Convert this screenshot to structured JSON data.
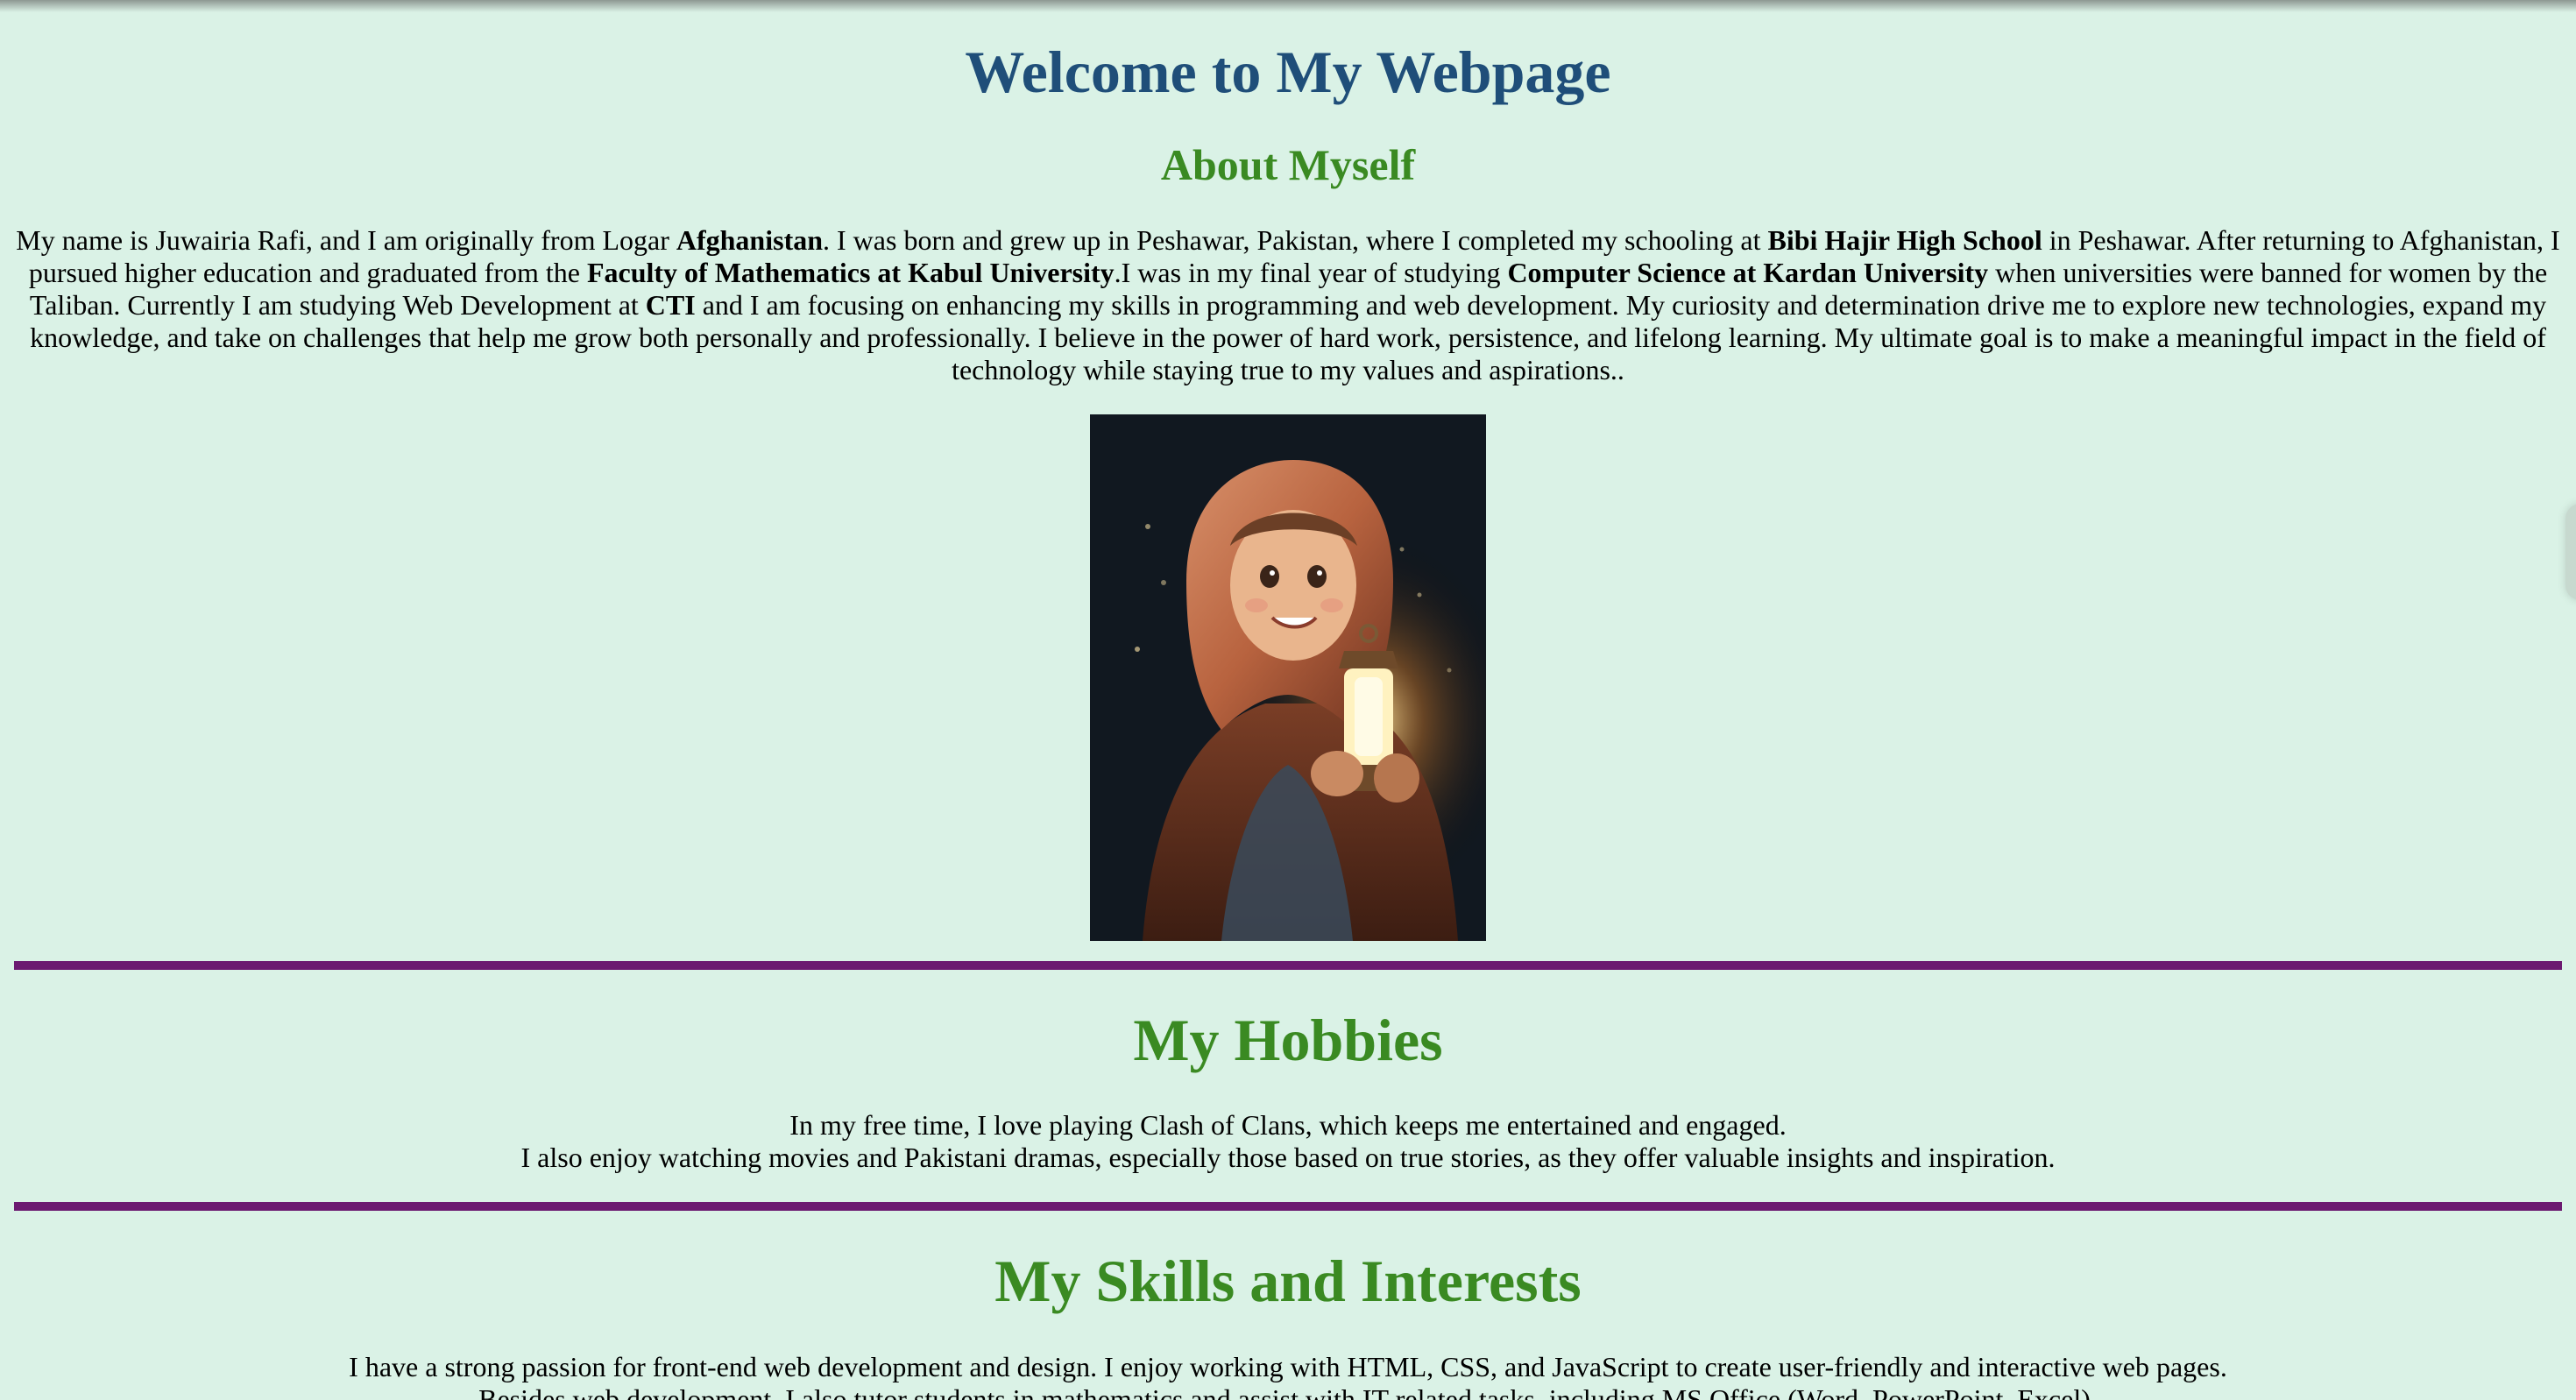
{
  "header": {
    "title": "Welcome to My Webpage"
  },
  "about": {
    "heading": "About Myself",
    "segments": [
      {
        "text": "My name is Juwairia Rafi, and I am originally from Logar ",
        "bold": false
      },
      {
        "text": "Afghanistan",
        "bold": true
      },
      {
        "text": ". I was born and grew up in Peshawar, Pakistan, where I completed my schooling at ",
        "bold": false
      },
      {
        "text": "Bibi Hajir High School",
        "bold": true
      },
      {
        "text": " in Peshawar. After returning to Afghanistan, I pursued higher education and graduated from the ",
        "bold": false
      },
      {
        "text": "Faculty of Mathematics at Kabul University",
        "bold": true
      },
      {
        "text": ".I was in my final year of studying ",
        "bold": false
      },
      {
        "text": "Computer Science at Kardan University",
        "bold": true
      },
      {
        "text": " when universities were banned for women by the Taliban. Currently I am studying Web Development at ",
        "bold": false
      },
      {
        "text": "CTI",
        "bold": true
      },
      {
        "text": " and I am focusing on enhancing my skills in programming and web development. My curiosity and determination drive me to explore new technologies, expand my knowledge, and take on challenges that help me grow both personally and professionally. I believe in the power of hard work, persistence, and lifelong learning. My ultimate goal is to make a meaningful impact in the field of technology while staying true to my values and aspirations..",
        "bold": false
      }
    ]
  },
  "hobbies": {
    "heading": "My Hobbies",
    "line1": "In my free time, I love playing Clash of Clans, which keeps me entertained and engaged.",
    "line2": "I also enjoy watching movies and Pakistani dramas, especially those based on true stories, as they offer valuable insights and inspiration."
  },
  "skills": {
    "heading": "My Skills and Interests",
    "line1": "I have a strong passion for front-end web development and design. I enjoy working with HTML, CSS, and JavaScript to create user-friendly and interactive web pages.",
    "line2": "Besides web development, I also tutor students in mathematics and assist with IT-related tasks, including MS Office (Word, PowerPoint, Excel)."
  },
  "colors": {
    "background": "#daf2e6",
    "title": "#1f4e79",
    "headings": "#3a8a22",
    "divider": "#6b1a70"
  }
}
